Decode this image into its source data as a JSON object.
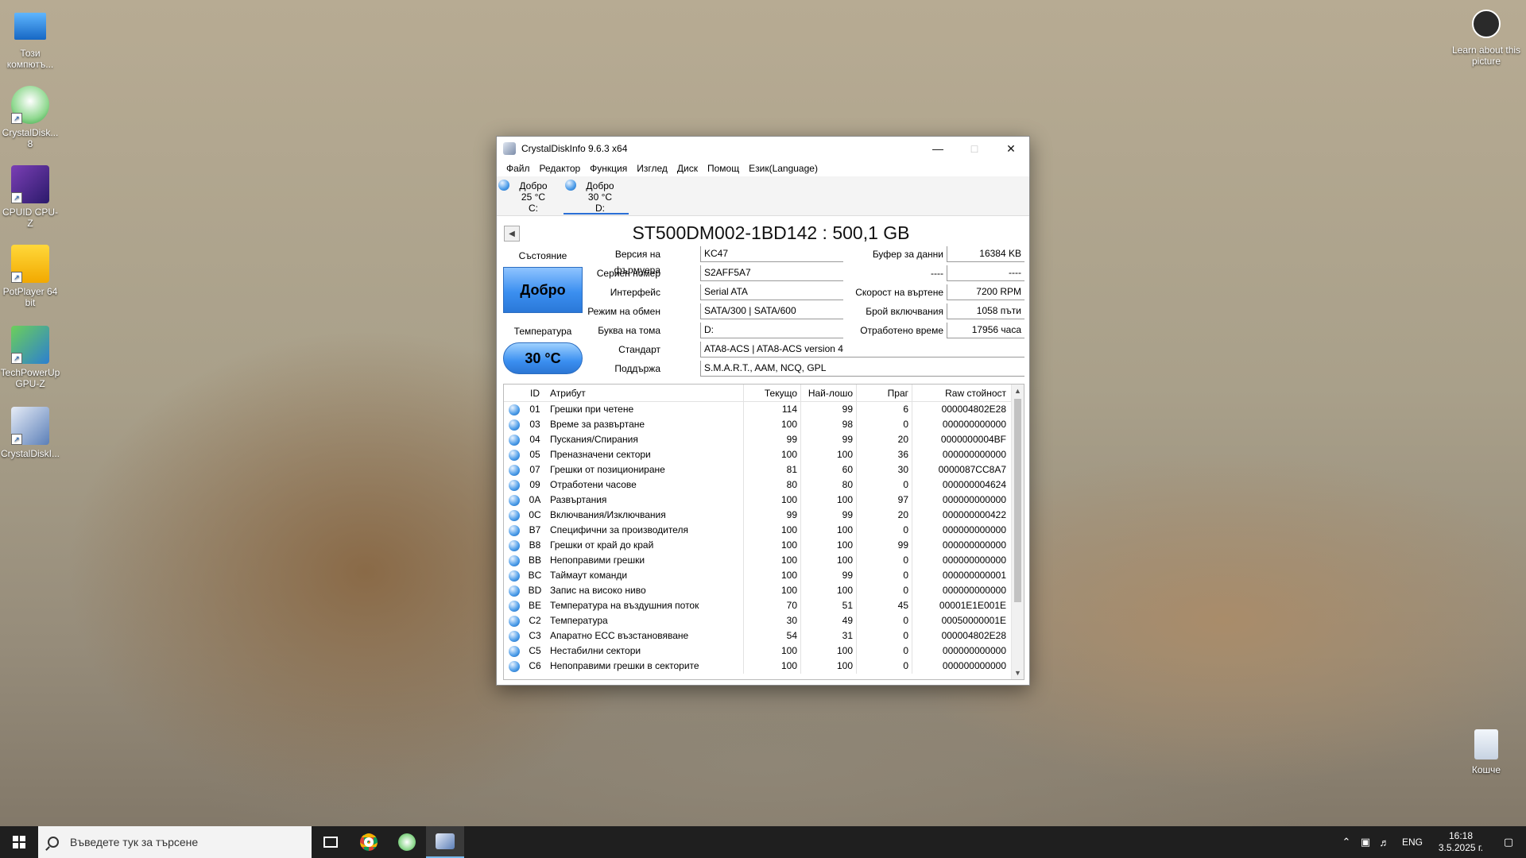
{
  "desktop": {
    "icons": [
      {
        "label": "Този компютъ..."
      },
      {
        "label": "CrystalDisk... 8"
      },
      {
        "label": "CPUID CPU-Z"
      },
      {
        "label": "PotPlayer 64 bit"
      },
      {
        "label": "TechPowerUp GPU-Z"
      },
      {
        "label": "CrystalDiskI..."
      }
    ],
    "learn_about": "Learn about this picture",
    "recycle_bin": "Кошче"
  },
  "window": {
    "title": "CrystalDiskInfo 9.6.3 x64",
    "menu": [
      "Файл",
      "Редактор",
      "Функция",
      "Изглед",
      "Диск",
      "Помощ",
      "Език(Language)"
    ],
    "drives": [
      {
        "status": "Добро",
        "temp": "25 °C",
        "letter": "C:"
      },
      {
        "status": "Добро",
        "temp": "30 °C",
        "letter": "D:"
      }
    ],
    "model": "ST500DM002-1BD142 : 500,1 GB",
    "status_label": "Състояние",
    "status_value": "Добро",
    "temp_label": "Температура",
    "temp_value": "30 °C",
    "fields": {
      "firmware_label": "Версия на фърмуера",
      "firmware": "KC47",
      "serial_label": "Сериен номер",
      "serial": "S2AFF5A7",
      "interface_label": "Интерфейс",
      "interface": "Serial ATA",
      "transfer_label": "Режим на обмен",
      "transfer": "SATA/300 | SATA/600",
      "volume_label": "Буква на тома",
      "volume": "D:",
      "standard_label": "Стандарт",
      "standard": "ATA8-ACS | ATA8-ACS version 4",
      "features_label": "Поддържа",
      "features": "S.M.A.R.T., AAM, NCQ, GPL",
      "buffer_label": "Буфер за данни",
      "buffer": "16384 KB",
      "blank_label": "----",
      "blank": "----",
      "rotation_label": "Скорост на въртене",
      "rotation": "7200 RPM",
      "poweron_count_label": "Брой включвания",
      "poweron_count": "1058 пъти",
      "poweron_hours_label": "Отработено време",
      "poweron_hours": "17956 часа"
    },
    "table": {
      "headers": [
        "ID",
        "Атрибут",
        "Текущо",
        "Най-лошо",
        "Праг",
        "Raw стойност"
      ],
      "rows": [
        [
          "01",
          "Грешки при четене",
          "114",
          "99",
          "6",
          "000004802E28"
        ],
        [
          "03",
          "Време за развъртане",
          "100",
          "98",
          "0",
          "000000000000"
        ],
        [
          "04",
          "Пускания/Спирания",
          "99",
          "99",
          "20",
          "0000000004BF"
        ],
        [
          "05",
          "Преназначени сектори",
          "100",
          "100",
          "36",
          "000000000000"
        ],
        [
          "07",
          "Грешки от позициониране",
          "81",
          "60",
          "30",
          "0000087CC8A7"
        ],
        [
          "09",
          "Отработени часове",
          "80",
          "80",
          "0",
          "000000004624"
        ],
        [
          "0A",
          "Развъртания",
          "100",
          "100",
          "97",
          "000000000000"
        ],
        [
          "0C",
          "Включвания/Изключвания",
          "99",
          "99",
          "20",
          "000000000422"
        ],
        [
          "B7",
          "Специфични за производителя",
          "100",
          "100",
          "0",
          "000000000000"
        ],
        [
          "B8",
          "Грешки от край до край",
          "100",
          "100",
          "99",
          "000000000000"
        ],
        [
          "BB",
          "Непоправими грешки",
          "100",
          "100",
          "0",
          "000000000000"
        ],
        [
          "BC",
          "Таймаут команди",
          "100",
          "99",
          "0",
          "000000000001"
        ],
        [
          "BD",
          "Запис на високо ниво",
          "100",
          "100",
          "0",
          "000000000000"
        ],
        [
          "BE",
          "Температура на въздушния поток",
          "70",
          "51",
          "45",
          "00001E1E001E"
        ],
        [
          "C2",
          "Температура",
          "30",
          "49",
          "0",
          "00050000001E"
        ],
        [
          "C3",
          "Апаратно ECC възстановяване",
          "54",
          "31",
          "0",
          "000004802E28"
        ],
        [
          "C5",
          "Нестабилни сектори",
          "100",
          "100",
          "0",
          "000000000000"
        ],
        [
          "C6",
          "Непоправими грешки в секторите",
          "100",
          "100",
          "0",
          "000000000000"
        ]
      ]
    }
  },
  "taskbar": {
    "search_placeholder": "Въведете тук за търсене",
    "lang": "ENG",
    "time": "16:18",
    "date": "3.5.2025 г."
  }
}
